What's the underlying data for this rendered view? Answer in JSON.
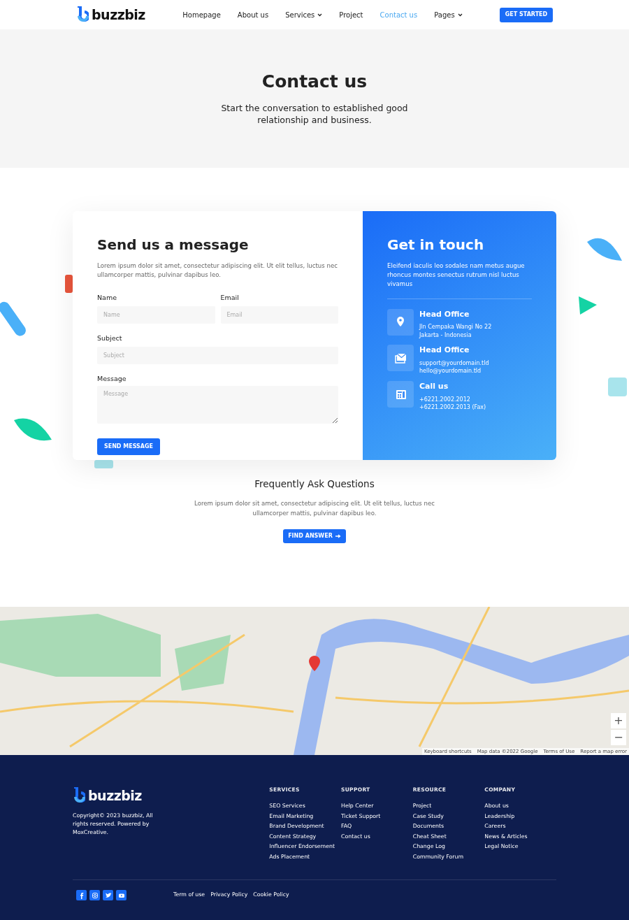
{
  "navbar": {
    "brand": "buzzbiz",
    "items": [
      {
        "label": "Homepage",
        "selected": false,
        "dropdown": false
      },
      {
        "label": "About us",
        "selected": false,
        "dropdown": false
      },
      {
        "label": "Services",
        "selected": false,
        "dropdown": true
      },
      {
        "label": "Project",
        "selected": false,
        "dropdown": false
      },
      {
        "label": "Contact us",
        "selected": true,
        "dropdown": false
      },
      {
        "label": "Pages",
        "selected": false,
        "dropdown": true
      }
    ],
    "cta": "GET STARTED"
  },
  "hero": {
    "title": "Contact us",
    "subtitle": "Start the conversation to established good relationship and business."
  },
  "form": {
    "title": "Send us a message",
    "description": "Lorem ipsum dolor sit amet, consectetur adipiscing elit. Ut elit tellus, luctus nec ullamcorper mattis, pulvinar dapibus leo.",
    "fields": [
      {
        "label": "Name",
        "placeholder": "Name",
        "kind": "input"
      },
      {
        "label": "Email",
        "placeholder": "Email",
        "kind": "input"
      },
      {
        "label": "Subject",
        "placeholder": "Subject",
        "kind": "input"
      },
      {
        "label": "Message",
        "placeholder": "Message",
        "kind": "textarea"
      }
    ],
    "submit": "SEND MESSAGE"
  },
  "contact": {
    "title": "Get in touch",
    "description": "Eleifend iaculis leo sodales nam metus augue rhoncus montes senectus rutrum nisl luctus vivamus",
    "items": [
      {
        "kind": "location",
        "title": "Head Office",
        "lines": [
          "Jln Cempaka Wangi No 22",
          "Jakarta - Indonesia"
        ]
      },
      {
        "kind": "email",
        "title": "Head Office",
        "lines": [
          "support@yourdomain.tld",
          "hello@yourdomain.tld"
        ]
      },
      {
        "kind": "phone",
        "title": "Call us",
        "lines": [
          "+6221.2002.2012",
          "+6221.2002.2013 (Fax)"
        ]
      }
    ]
  },
  "faq": {
    "title": "Frequently Ask Questions",
    "description": "Lorem ipsum dolor sit amet, consectetur adipiscing elit. Ut elit tellus, luctus nec ullamcorper mattis, pulvinar dapibus leo.",
    "button": "FIND ANSWER"
  },
  "map": {
    "zoom_in": "+",
    "zoom_out": "−",
    "attribution": [
      "Keyboard shortcuts",
      "Map data ©2022 Google",
      "Terms of Use",
      "Report a map error"
    ]
  },
  "footer": {
    "brand": "buzzbiz",
    "copyright": "Copyright© 2023 buzzbiz, All rights reserved. Powered by MoxCreative.",
    "columns": [
      {
        "title": "SERVICES",
        "links": [
          "SEO Services",
          "Email Marketing",
          "Brand Development",
          "Content Strategy",
          "Influencer Endorsement",
          "Ads Placement"
        ]
      },
      {
        "title": "SUPPORT",
        "links": [
          "Help Center",
          "Ticket Support",
          "FAQ",
          "Contact us"
        ]
      },
      {
        "title": "RESOURCE",
        "links": [
          "Project",
          "Case Study",
          "Documents",
          "Cheat Sheet",
          "Change Log",
          "Community Forum"
        ]
      },
      {
        "title": "COMPANY",
        "links": [
          "About us",
          "Leadership",
          "Careers",
          "News & Articles",
          "Legal Notice"
        ]
      }
    ],
    "social": [
      {
        "kind": "facebook"
      },
      {
        "kind": "instagram"
      },
      {
        "kind": "twitter"
      },
      {
        "kind": "youtube"
      }
    ],
    "legal": [
      "Term of use",
      "Privacy Policy",
      "Cookie Policy"
    ]
  }
}
